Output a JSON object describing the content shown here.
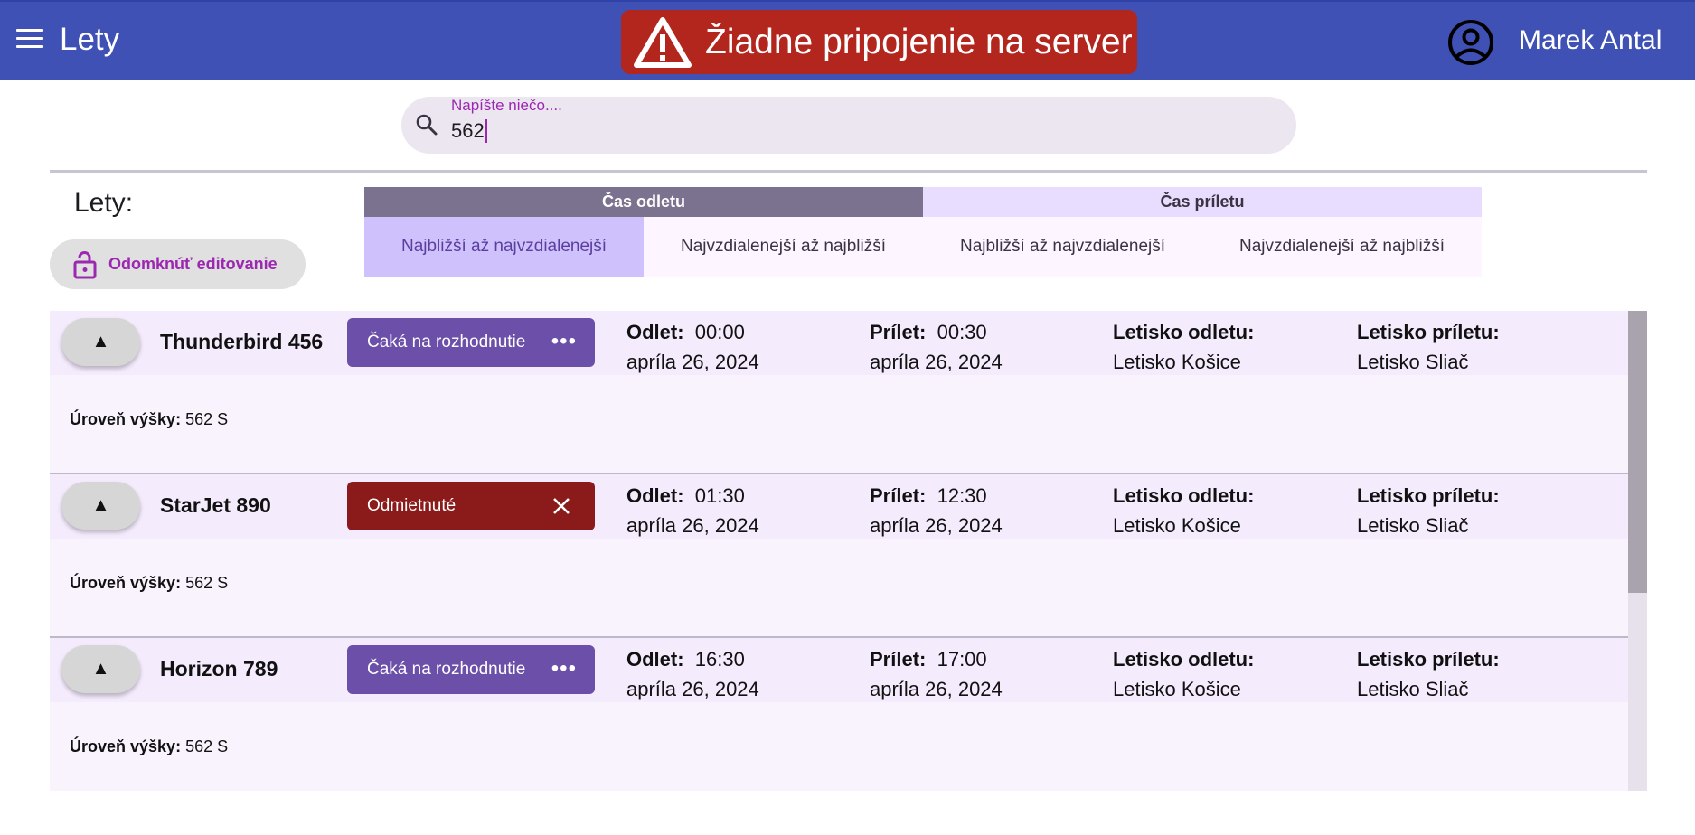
{
  "header": {
    "title": "Lety",
    "alert": "Žiadne pripojenie na server",
    "user_name": "Marek Antal"
  },
  "search": {
    "label": "Napíšte niečo....",
    "value": "562"
  },
  "section": {
    "title": "Lety:",
    "unlock_label": "Odomknúť editovanie"
  },
  "sort": {
    "departure_header": "Čas odletu",
    "arrival_header": "Čas príletu",
    "options": [
      {
        "label": "Najbližší až najvzdialenejší",
        "active": true
      },
      {
        "label": "Najvzdialenejší až najbližší",
        "active": false
      },
      {
        "label": "Najbližší až najvzdialenejší",
        "active": false
      },
      {
        "label": "Najvzdialenejší až najbližší",
        "active": false
      }
    ]
  },
  "labels": {
    "departure": "Odlet:",
    "arrival": "Prílet:",
    "departure_airport": "Letisko odletu:",
    "arrival_airport": "Letisko príletu:",
    "altitude": "Úroveň výšky:"
  },
  "flights": [
    {
      "name": "Thunderbird 456",
      "status": "Čaká na rozhodnutie",
      "status_type": "pending",
      "departure_time": "00:00",
      "departure_date": "apríla 26, 2024",
      "arrival_time": "00:30",
      "arrival_date": "apríla 26, 2024",
      "departure_airport": "Letisko Košice",
      "arrival_airport": "Letisko Sliač",
      "altitude": "562 S"
    },
    {
      "name": "StarJet 890",
      "status": "Odmietnuté",
      "status_type": "rejected",
      "departure_time": "01:30",
      "departure_date": "apríla 26, 2024",
      "arrival_time": "12:30",
      "arrival_date": "apríla 26, 2024",
      "departure_airport": "Letisko Košice",
      "arrival_airport": "Letisko Sliač",
      "altitude": "562 S"
    },
    {
      "name": "Horizon 789",
      "status": "Čaká na rozhodnutie",
      "status_type": "pending",
      "departure_time": "16:30",
      "departure_date": "apríla 26, 2024",
      "arrival_time": "17:00",
      "arrival_date": "apríla 26, 2024",
      "departure_airport": "Letisko Košice",
      "arrival_airport": "Letisko Sliač",
      "altitude": "562 S"
    }
  ],
  "colors": {
    "appbar": "#3f51b5",
    "alert": "#b3261e",
    "pending": "#6b4fa8",
    "rejected": "#8b1a1a",
    "accent": "#9c27b0"
  },
  "icons": {
    "menu": "menu-icon",
    "alert": "warning-icon",
    "user": "account-circle-icon",
    "search": "search-icon",
    "unlock": "lock-open-icon",
    "expand": "triangle-up-icon",
    "pending": "more-horiz-icon",
    "rejected": "close-icon"
  }
}
